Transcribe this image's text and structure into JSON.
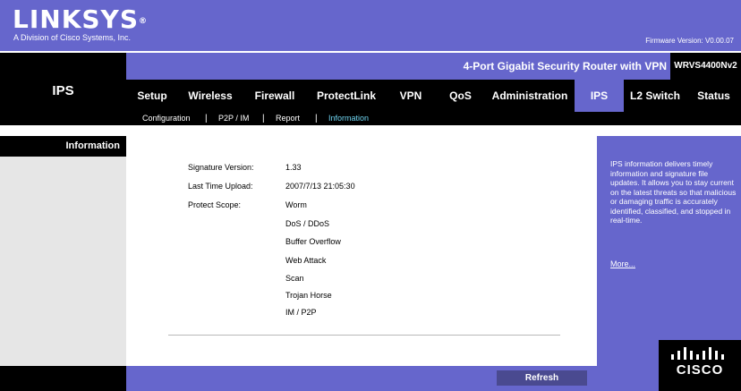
{
  "brand": {
    "logo": "LINKSYS",
    "logo_mark": "®",
    "subtitle": "A Division of Cisco Systems, Inc.",
    "firmware": "Firmware Version: V0.00.07"
  },
  "product": {
    "name": "4-Port Gigabit Security Router with VPN",
    "model": "WRVS4400Nv2"
  },
  "section_title": "IPS",
  "nav": {
    "items": [
      "Setup",
      "Wireless",
      "Firewall",
      "ProtectLink",
      "VPN",
      "QoS",
      "Administration",
      "IPS",
      "L2 Switch",
      "Status"
    ],
    "active": "IPS"
  },
  "subnav": {
    "items": [
      "Configuration",
      "P2P / IM",
      "Report",
      "Information"
    ],
    "active": "Information"
  },
  "left_label": "Information",
  "info": {
    "signature_version_label": "Signature Version:",
    "signature_version": "1.33",
    "last_upload_label": "Last Time Upload:",
    "last_upload": "2007/7/13 21:05:30",
    "protect_scope_label": "Protect Scope:",
    "protect_scope": [
      "Worm",
      "DoS / DDoS",
      "Buffer Overflow",
      "Web Attack",
      "Scan",
      "Trojan Horse",
      "IM / P2P"
    ]
  },
  "help": {
    "text": "IPS information delivers timely information and signature file updates. It allows you to stay current on the latest threats so that malicious or damaging traffic is accurately identified, classified, and stopped in real-time.",
    "more": "More..."
  },
  "footer": {
    "refresh_label": "Refresh",
    "cisco_logo": "CISCO"
  },
  "colors": {
    "accent": "#6666cc",
    "active_subnav": "#6fd4f0",
    "button": "#4a4a90"
  }
}
